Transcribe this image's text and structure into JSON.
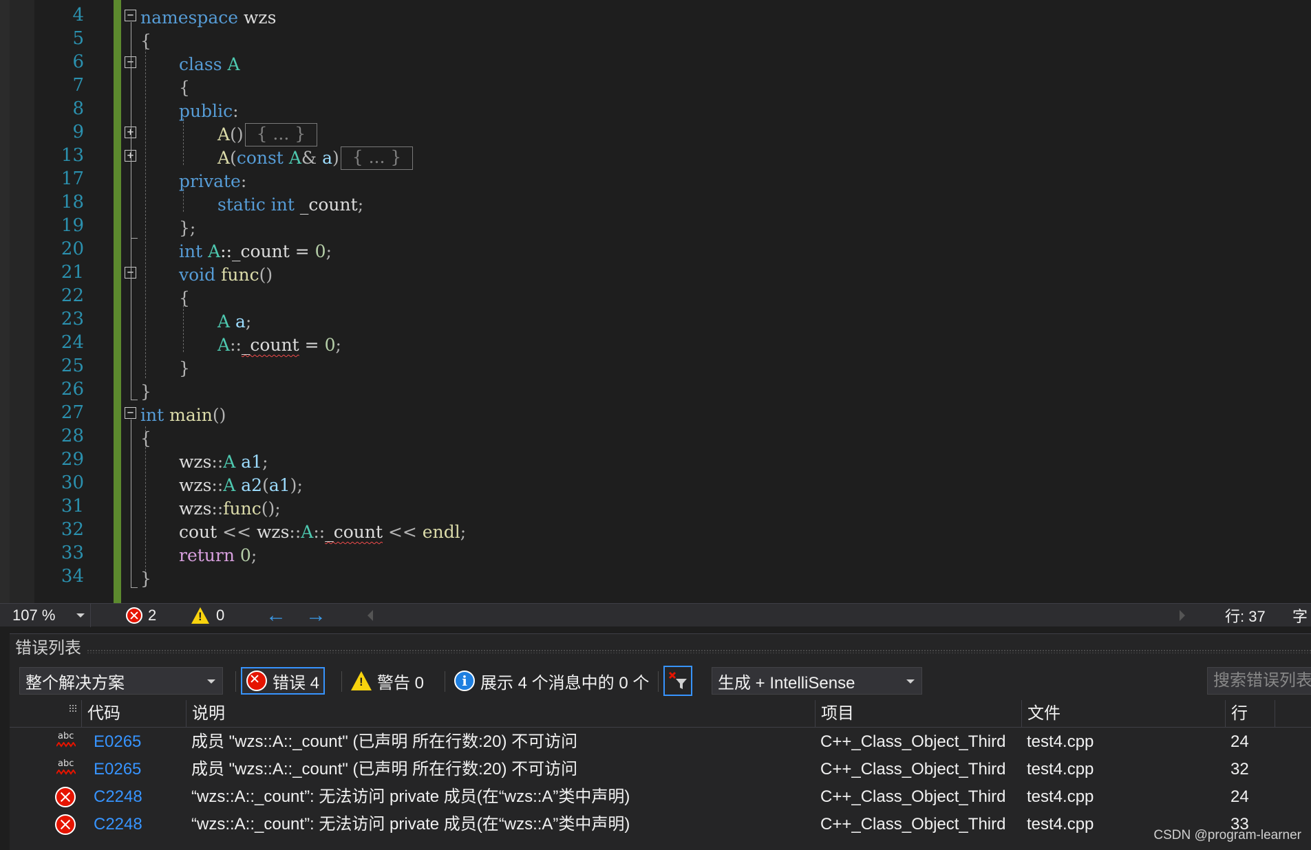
{
  "editor": {
    "line_numbers": [
      "4",
      "5",
      "6",
      "7",
      "8",
      "9",
      "13",
      "17",
      "18",
      "19",
      "20",
      "21",
      "22",
      "23",
      "24",
      "25",
      "26",
      "27",
      "28",
      "29",
      "30",
      "31",
      "32",
      "33",
      "34"
    ],
    "code": {
      "l4": {
        "kw": "namespace",
        "name": " wzs"
      },
      "l5": "{",
      "l6": {
        "kw": "class",
        "name": "A"
      },
      "l7": "{",
      "l8": {
        "kw": "public",
        "pun": ":"
      },
      "l9": {
        "fn": "A",
        "pun": "()",
        "collapsed": "{ ... }"
      },
      "l13": {
        "fn": "A",
        "pun1": "(",
        "kw": "const",
        "ty": "A",
        "pun2": "& ",
        "var": "a",
        "pun3": ")",
        "collapsed": "{ ... }"
      },
      "l17": {
        "kw": "private",
        "pun": ":"
      },
      "l18": {
        "kw1": "static",
        "kw2": "int",
        "name": " _count",
        "pun": ";"
      },
      "l19": "};",
      "l20": {
        "kw": "int",
        "ty": "A",
        "rest": "::_count = ",
        "num": "0",
        "end": ";"
      },
      "l21": {
        "kw": "void",
        "fn": "func",
        "pun": "()"
      },
      "l22": "{",
      "l23": {
        "ty": "A",
        "var": "a",
        "pun": ";"
      },
      "l24": {
        "ty": "A",
        "pun": "::",
        "sq": "_count",
        "rest": " = ",
        "num": "0",
        "end": ";"
      },
      "l25": "}",
      "l26": "}",
      "l27": {
        "kw": "int",
        "fn": "main",
        "pun": "()"
      },
      "l28": "{",
      "l29": {
        "ns": "wzs",
        "pun": "::",
        "ty": "A",
        "var": "a1",
        "end": ";"
      },
      "l30": {
        "ns": "wzs",
        "pun": "::",
        "ty": "A",
        "var": "a2",
        "arg": "a1",
        "end": ";"
      },
      "l31": {
        "ns": "wzs",
        "pun": "::",
        "fn": "func",
        "call": "();"
      },
      "l32": {
        "cout": "cout",
        "op1": " << ",
        "ns": "wzs",
        "pun1": "::",
        "ty": "A",
        "pun2": "::",
        "sq": "_count",
        "op2": " << ",
        "endl": "endl",
        "end": ";"
      },
      "l33": {
        "ctl": "return",
        "num": "0",
        "end": ";"
      },
      "l34": "}"
    }
  },
  "navbar": {
    "zoom": "107 %",
    "errors": "2",
    "warnings": "0",
    "line_label": "行: 37",
    "col_label": "字"
  },
  "error_list": {
    "title": "错误列表",
    "scope": "整个解决方案",
    "errors_btn": "错误 4",
    "warnings_btn": "警告 0",
    "messages_btn": "展示 4 个消息中的 0 个",
    "build_filter": "生成 + IntelliSense",
    "search_placeholder": "搜索错误列表",
    "columns": {
      "code": "代码",
      "desc": "说明",
      "project": "项目",
      "file": "文件",
      "line": "行"
    },
    "rows": [
      {
        "icon": "intellisense-error-icon",
        "code": "E0265",
        "desc": "成员 \"wzs::A::_count\" (已声明 所在行数:20) 不可访问",
        "project": "C++_Class_Object_Third",
        "file": "test4.cpp",
        "line": "24"
      },
      {
        "icon": "intellisense-error-icon",
        "code": "E0265",
        "desc": "成员 \"wzs::A::_count\" (已声明 所在行数:20) 不可访问",
        "project": "C++_Class_Object_Third",
        "file": "test4.cpp",
        "line": "32"
      },
      {
        "icon": "error-icon",
        "code": "C2248",
        "desc": "“wzs::A::_count”: 无法访问 private 成员(在“wzs::A”类中声明)",
        "project": "C++_Class_Object_Third",
        "file": "test4.cpp",
        "line": "24"
      },
      {
        "icon": "error-icon",
        "code": "C2248",
        "desc": "“wzs::A::_count”: 无法访问 private 成员(在“wzs::A”类中声明)",
        "project": "C++_Class_Object_Third",
        "file": "test4.cpp",
        "line": "33"
      }
    ]
  },
  "watermark": "CSDN @program-learner",
  "colors": {
    "keyword": "#569cd6",
    "type": "#4ec9b0",
    "function": "#dcdcaa",
    "variable": "#9cdcfe",
    "number": "#b5cea8",
    "control": "#d8a0df",
    "error": "#e51400",
    "accent": "#3794ff"
  }
}
